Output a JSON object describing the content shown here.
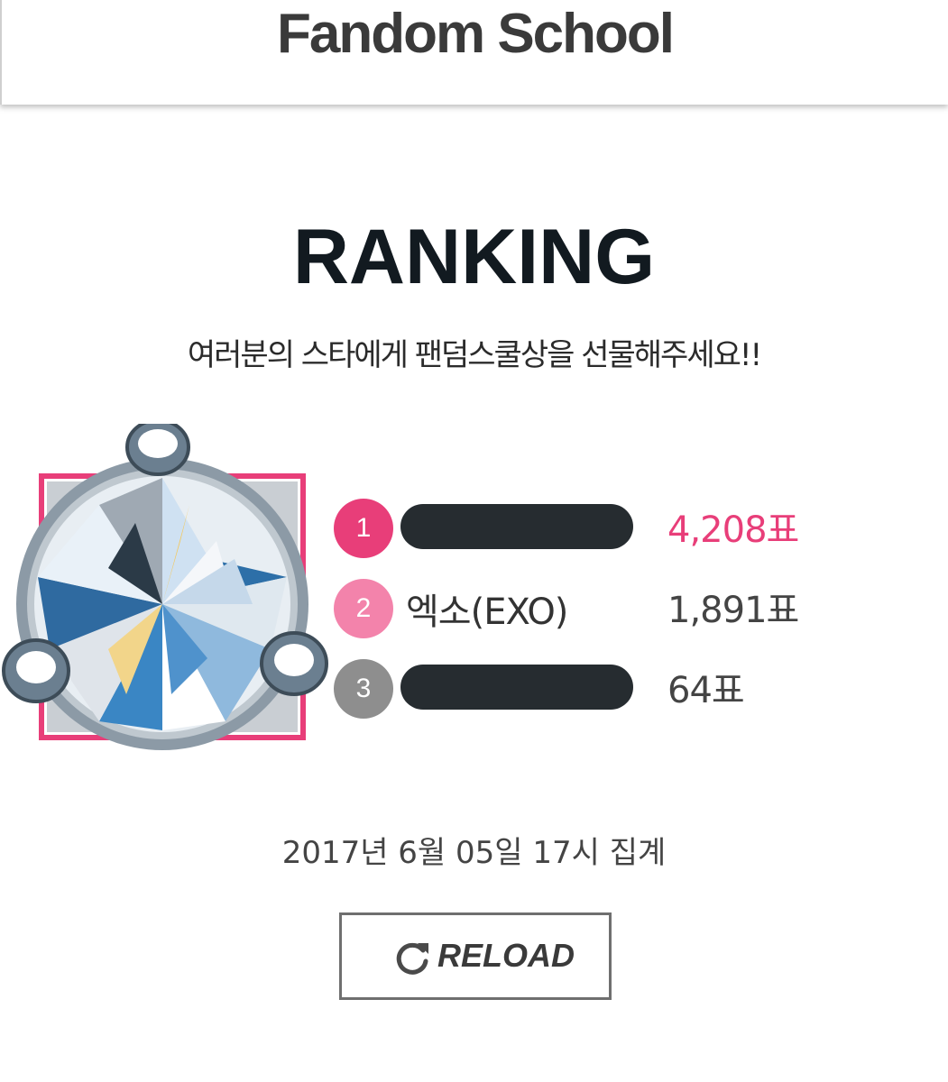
{
  "header": {
    "title": "Fandom School"
  },
  "ranking": {
    "title": "RANKING",
    "subtitle": "여러분의 스타에게 팬덤스쿨상을 선물해주세요!!",
    "entries": [
      {
        "rank": "1",
        "name": "",
        "name_redacted": true,
        "votes": "4,208표",
        "badge_color": "#e83e79",
        "votes_color": "#e83e79"
      },
      {
        "rank": "2",
        "name": "엑소(EXO)",
        "name_redacted": false,
        "votes": "1,891표",
        "badge_color": "#f383ab",
        "votes_color": "#444444"
      },
      {
        "rank": "3",
        "name": "",
        "name_redacted": true,
        "votes": "64표",
        "badge_color": "#8e8e8e",
        "votes_color": "#444444"
      }
    ]
  },
  "award": {
    "icon": "diamond-icon",
    "frame_color": "#e83e79"
  },
  "timestamp": "2017년 6월 05일 17시 집계",
  "reload": {
    "label": "RELOAD",
    "icon": "reload-icon"
  }
}
